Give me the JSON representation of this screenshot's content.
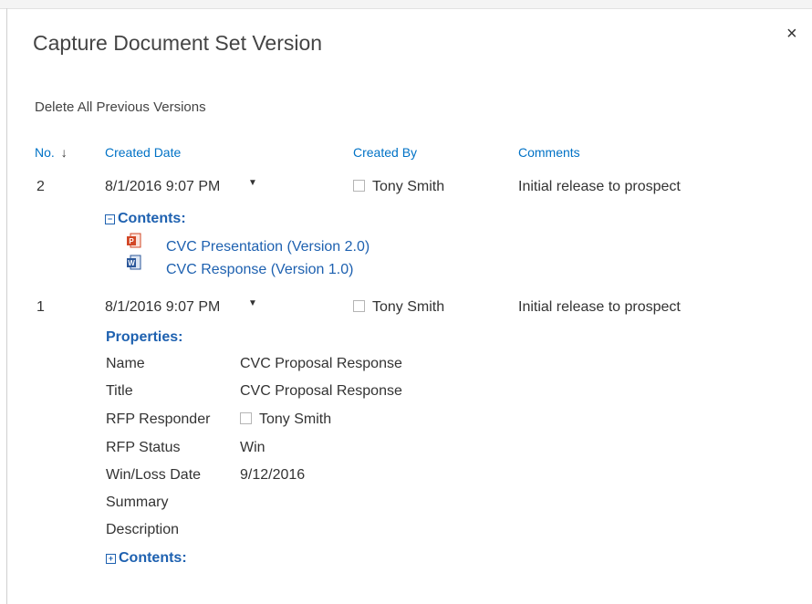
{
  "dialog": {
    "title": "Capture Document Set Version",
    "close_glyph": "×",
    "delete_link": "Delete All Previous Versions"
  },
  "table": {
    "headers": {
      "no": "No.",
      "sort_glyph": "↓",
      "created_date": "Created Date",
      "created_by": "Created By",
      "comments": "Comments"
    },
    "versions": [
      {
        "no": "2",
        "created_date": "8/1/2016 9:07 PM",
        "dropdown_glyph": "▼",
        "created_by": "Tony Smith",
        "comments": "Initial release to prospect",
        "contents_toggle": "−",
        "contents_label": "Contents:",
        "contents": [
          {
            "name": "CVC Presentation (Version 2.0)",
            "icon": "powerpoint-file-icon",
            "color": "#d24726"
          },
          {
            "name": "CVC Response (Version 1.0)",
            "icon": "word-file-icon",
            "color": "#2b579a"
          }
        ]
      },
      {
        "no": "1",
        "created_date": "8/1/2016 9:07 PM",
        "dropdown_glyph": "▼",
        "created_by": "Tony Smith",
        "comments": "Initial release to prospect",
        "properties_label": "Properties:",
        "properties": [
          {
            "label": "Name",
            "value": "CVC Proposal Response"
          },
          {
            "label": "Title",
            "value": "CVC Proposal Response"
          },
          {
            "label": "RFP Responder",
            "value": "Tony Smith"
          },
          {
            "label": "RFP Status",
            "value": "Win"
          },
          {
            "label": "Win/Loss Date",
            "value": "9/12/2016"
          },
          {
            "label": "Summary",
            "value": ""
          },
          {
            "label": "Description",
            "value": ""
          }
        ],
        "contents_toggle": "+",
        "contents_label": "Contents:"
      }
    ]
  },
  "colors": {
    "link": "#1e61b0",
    "header": "#0072c6",
    "text": "#333333"
  }
}
